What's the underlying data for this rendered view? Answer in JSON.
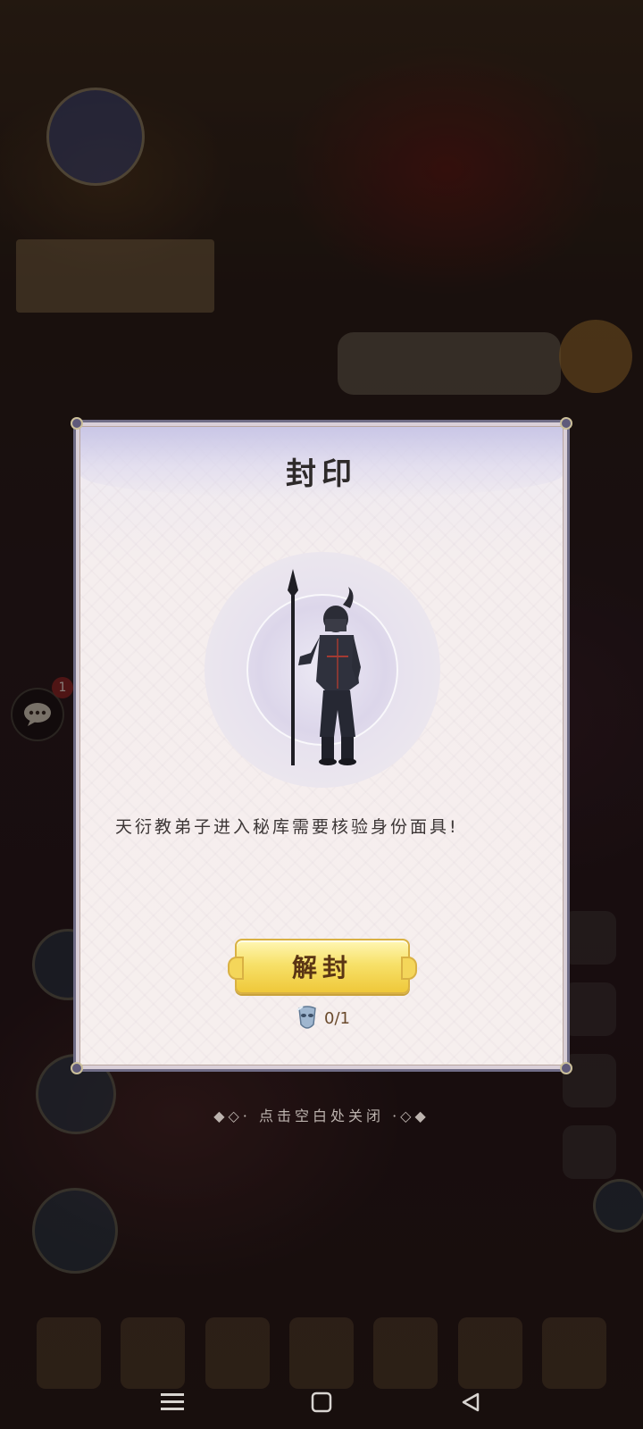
{
  "popup": {
    "title": "封印",
    "description": "天衍教弟子进入秘库需要核验身份面具!",
    "unseal_label": "解封",
    "cost_count": "0/1",
    "portrait": "guard-spearman-portrait",
    "cost_item_icon": "mask-icon"
  },
  "close_hint": "点击空白处关闭",
  "background": {
    "chat_badge": "1"
  },
  "colors": {
    "dialog_border": "#6f6c86",
    "button_gold": "#f7e16a",
    "button_text": "#5a3514"
  }
}
